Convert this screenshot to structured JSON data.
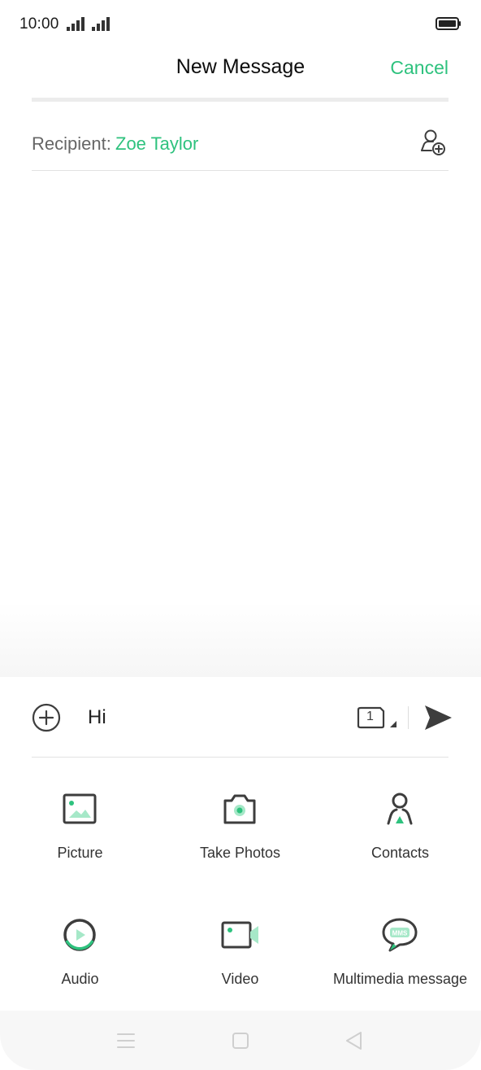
{
  "status_bar": {
    "time": "10:00",
    "icons": [
      "signal-icon",
      "signal-icon",
      "battery-icon"
    ]
  },
  "header": {
    "title": "New Message",
    "cancel_label": "Cancel"
  },
  "recipient": {
    "label": "Recipient:",
    "name": "Zoe Taylor",
    "add_icon": "add-contact-icon"
  },
  "compose": {
    "message_text": "Hi",
    "sim_slot": "1",
    "icons": [
      "plus-circle-icon",
      "sim-card-icon",
      "send-icon"
    ]
  },
  "attachments": [
    {
      "label": "Picture",
      "icon": "picture-icon"
    },
    {
      "label": "Take Photos",
      "icon": "camera-icon"
    },
    {
      "label": "Contacts",
      "icon": "contacts-icon"
    },
    {
      "label": "Audio",
      "icon": "audio-icon"
    },
    {
      "label": "Video",
      "icon": "video-icon"
    },
    {
      "label": "Multimedia message",
      "icon": "mms-icon"
    }
  ],
  "nav_bar": {
    "icons": [
      "menu-icon",
      "home-icon",
      "back-icon"
    ]
  },
  "colors": {
    "accent": "#2ec27e",
    "icon_dark": "#3d3d3d",
    "text_gray": "#666666"
  }
}
